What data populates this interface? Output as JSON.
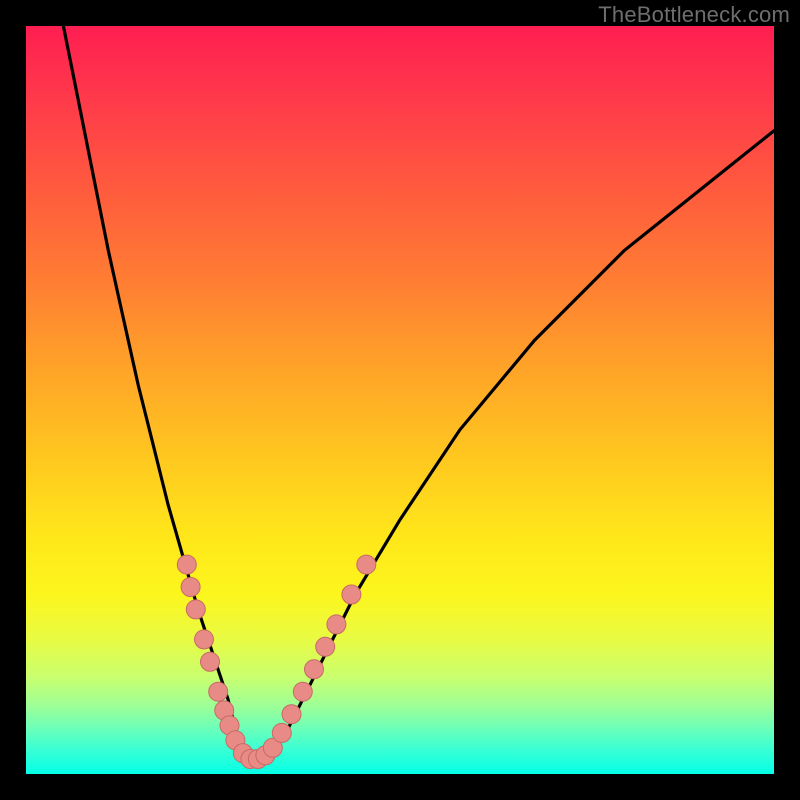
{
  "watermark": "TheBottleneck.com",
  "colors": {
    "frame": "#000000",
    "curve": "#000000",
    "dot_fill": "#e88b86",
    "dot_stroke": "#c76a66",
    "gradient_top": "#ff1e52",
    "gradient_bottom": "#05ffe7"
  },
  "chart_data": {
    "type": "line",
    "title": "",
    "xlabel": "",
    "ylabel": "",
    "xlim": [
      0,
      100
    ],
    "ylim": [
      0,
      100
    ],
    "annotations": [
      "TheBottleneck.com"
    ],
    "series": [
      {
        "name": "bottleneck-curve",
        "x": [
          5,
          7,
          9,
          11,
          13,
          15,
          17,
          19,
          21,
          23,
          25,
          27,
          28,
          29,
          30,
          31,
          33,
          35,
          37,
          40,
          44,
          50,
          58,
          68,
          80,
          95,
          100
        ],
        "y": [
          100,
          90,
          80,
          70,
          61,
          52,
          44,
          36,
          29,
          22,
          16,
          10,
          6,
          3,
          2,
          2,
          3,
          6,
          10,
          16,
          24,
          34,
          46,
          58,
          70,
          82,
          86
        ]
      }
    ],
    "highlight_points": {
      "name": "cluster-dots",
      "points": [
        {
          "x": 21.5,
          "y": 28
        },
        {
          "x": 22.0,
          "y": 25
        },
        {
          "x": 22.7,
          "y": 22
        },
        {
          "x": 23.8,
          "y": 18
        },
        {
          "x": 24.6,
          "y": 15
        },
        {
          "x": 25.7,
          "y": 11
        },
        {
          "x": 26.5,
          "y": 8.5
        },
        {
          "x": 27.2,
          "y": 6.5
        },
        {
          "x": 28.0,
          "y": 4.5
        },
        {
          "x": 29.0,
          "y": 2.8
        },
        {
          "x": 30.0,
          "y": 2
        },
        {
          "x": 31.0,
          "y": 2
        },
        {
          "x": 32.0,
          "y": 2.5
        },
        {
          "x": 33.0,
          "y": 3.5
        },
        {
          "x": 34.2,
          "y": 5.5
        },
        {
          "x": 35.5,
          "y": 8
        },
        {
          "x": 37.0,
          "y": 11
        },
        {
          "x": 38.5,
          "y": 14
        },
        {
          "x": 40.0,
          "y": 17
        },
        {
          "x": 41.5,
          "y": 20
        },
        {
          "x": 43.5,
          "y": 24
        },
        {
          "x": 45.5,
          "y": 28
        }
      ]
    }
  }
}
